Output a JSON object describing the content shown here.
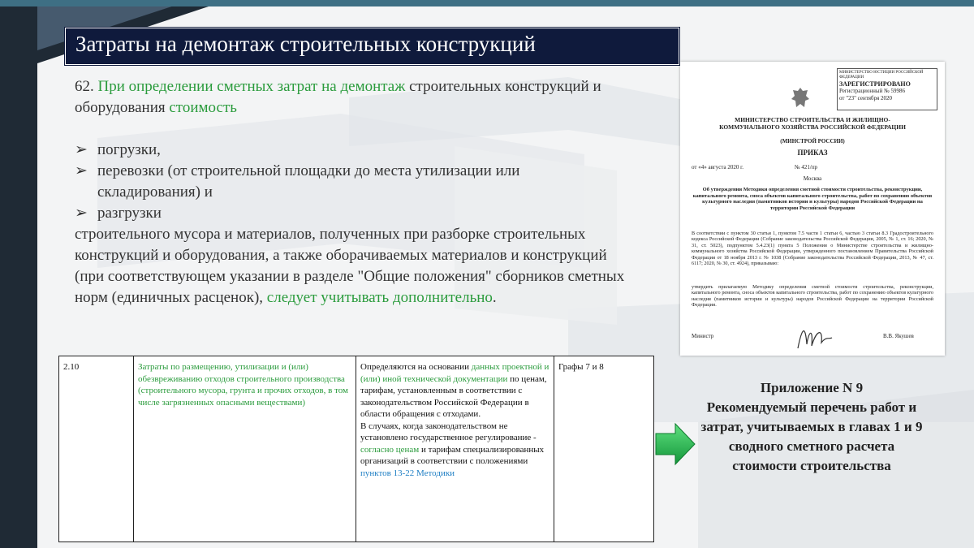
{
  "slide": {
    "title": "Затраты на демонтаж строительных конструкций"
  },
  "main": {
    "intro_num": "62. ",
    "intro_green1": "При определении сметных затрат на демонтаж",
    "intro_plain1": " строительных конструкций и оборудования ",
    "intro_green2": "стоимость",
    "bullets": [
      "погрузки,",
      "перевозки (от строительной площадки до места утилизации или складирования) и",
      "разгрузки"
    ],
    "para": "строительного мусора и материалов, полученных при разборке строительных конструкций и оборудования, а также оборачиваемых материалов и конструкций (при соответствующем указании в разделе \"Общие положения\" сборников сметных норм (единичных расценок),",
    "para_green": "следует учитывать дополнительно",
    "para_end": "."
  },
  "document": {
    "stamp_line1": "МИНИСТЕРСТВО ЮСТИЦИИ РОССИЙСКОЙ ФЕДЕРАЦИИ",
    "stamp_line2": "ЗАРЕГИСТРИРОВАНО",
    "stamp_line3": "Регистрационный № 59986",
    "stamp_line4": "от \"23\" сентября 2020",
    "ministry": "МИНИСТЕРСТВО СТРОИТЕЛЬСТВА И ЖИЛИЩНО-КОММУНАЛЬНОГО ХОЗЯЙСТВА РОССИЙСКОЙ ФЕДЕРАЦИИ",
    "short": "(МИНСТРОЙ РОССИИ)",
    "order": "ПРИКАЗ",
    "date_line": "от «4» августа 2020 г.                                    № 421/пр",
    "city": "Москва",
    "subject": "Об утверждении Методики определения сметной стоимости строительства, реконструкции, капитального ремонта, сноса объектов капитального строительства, работ по сохранению объектов культурного наследия (памятников истории и культуры) народов Российской Федерации на территории Российской Федерации",
    "body1": "В соответствии с пунктом 30 статьи 1, пунктом 7.5 части 1 статьи 6, частью 3 статьи 8.3 Градостроительного кодекса Российской Федерации (Собрание законодательства Российской Федерации, 2005, № 1, ст. 16; 2020, № 31, ст. 5023), подпунктом 5.4.23(1) пункта 5 Положения о Министерстве строительства и жилищно-коммунального хозяйства Российской Федерации, утвержденного постановлением Правительства Российской Федерации от 18 ноября 2013 г. № 1038 (Собрание законодательства Российской Федерации, 2013, № 47, ст. 6117; 2020, № 30, ст. 4924), приказываю:",
    "body2": "утвердить прилагаемую Методику определения сметной стоимости строительства, реконструкции, капитального ремонта, сноса объектов капитального строительства, работ по сохранению объектов культурного наследия (памятников истории и культуры) народов Российской Федерации на территории Российской Федерации.",
    "signer_role": "Министр",
    "signer_name": "В.В. Якушев"
  },
  "table": {
    "col1": "2.10",
    "col2": "Затраты по размещению, утилизации и (или) обезвреживанию отходов строительного производства (строительного мусора, грунта и прочих отходов, в том числе загрязненных опасными веществами)",
    "col3_a": "Определяются на основании ",
    "col3_g1": "данных проектной и (или) иной технической документации",
    "col3_b": " по ценам, тарифам, установленным в соответствии с законодательством Российской Федерации в области обращения с отходами.",
    "col3_c": "В случаях, когда законодательством не установлено государственное регулирование - ",
    "col3_g2": "согласно ценам",
    "col3_d": " и тарифам специализированных организаций в соответствии с положениями ",
    "col3_link": "пунктов 13-22 Методики",
    "col4": "Графы 7 и 8"
  },
  "appendix": {
    "heading": "Приложение N 9",
    "text": "Рекомендуемый перечень работ и затрат, учитываемых в главах 1 и 9 сводного сметного расчета стоимости строительства"
  },
  "colors": {
    "accent_green": "#2a9b3c",
    "title_bg": "#0f1a3c",
    "link_blue": "#1f7fc4",
    "arrow_green": "#1fb34a"
  }
}
